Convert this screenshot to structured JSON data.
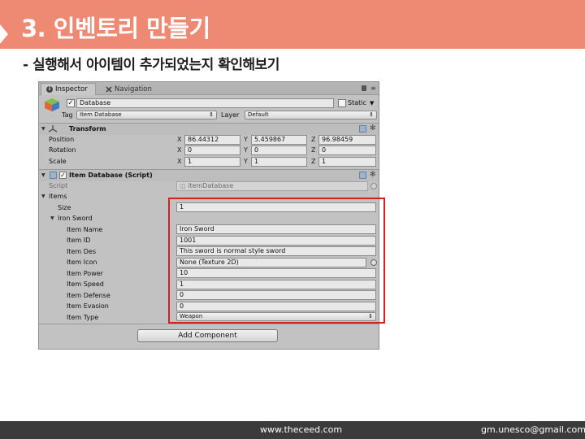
{
  "slide": {
    "title": "3. 인벤토리 만들기",
    "subtitle": "- 실행해서 아이템이 추가되었는지 확인해보기",
    "header_color": "#ee8a73",
    "highlight_color": "#d42020"
  },
  "inspector": {
    "tabs": [
      {
        "label": "Inspector",
        "icon": "info-icon",
        "active": true
      },
      {
        "label": "Navigation",
        "icon": "navigation-icon",
        "active": false
      }
    ],
    "gameobject": {
      "active": true,
      "name": "Database",
      "static_label": "Static",
      "static_checked": false,
      "tag_label": "Tag",
      "tag_value": "Item Database",
      "layer_label": "Layer",
      "layer_value": "Default"
    },
    "transform": {
      "title": "Transform",
      "position_label": "Position",
      "rotation_label": "Rotation",
      "scale_label": "Scale",
      "axis_x": "X",
      "axis_y": "Y",
      "axis_z": "Z",
      "position": [
        "86.44312",
        "5.459867",
        "96.98459"
      ],
      "rotation": [
        "0",
        "0",
        "0"
      ],
      "scale": [
        "1",
        "1",
        "1"
      ]
    },
    "script_component": {
      "title": "Item Database (Script)",
      "enabled": true,
      "script_label": "Script",
      "script_value": "itemDatabase",
      "items_label": "Items",
      "size_label": "Size",
      "size_value": "1",
      "element_label": "Iron Sword",
      "fields": [
        {
          "label": "Item Name",
          "value": "Iron Sword",
          "kind": "text"
        },
        {
          "label": "Item ID",
          "value": "1001",
          "kind": "text"
        },
        {
          "label": "Item Des",
          "value": "This sword is normal style sword",
          "kind": "text"
        },
        {
          "label": "Item Icon",
          "value": "None (Texture 2D)",
          "kind": "object"
        },
        {
          "label": "Item Power",
          "value": "10",
          "kind": "text"
        },
        {
          "label": "Item Speed",
          "value": "1",
          "kind": "text"
        },
        {
          "label": "Item Defense",
          "value": "0",
          "kind": "text"
        },
        {
          "label": "Item Evasion",
          "value": "0",
          "kind": "text"
        },
        {
          "label": "Item Type",
          "value": "Weapon",
          "kind": "enum"
        }
      ]
    },
    "add_component_label": "Add Component"
  },
  "footer": {
    "website": "www.theceed.com",
    "email": "gm.unesco@gmail.com"
  }
}
